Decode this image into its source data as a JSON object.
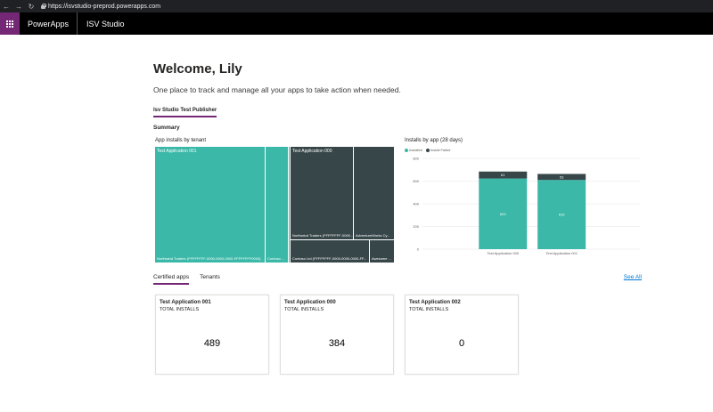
{
  "browser": {
    "back_icon": "←",
    "forward_icon": "→",
    "reload_icon": "↻",
    "url": "https://isvstudio-preprod.powerapps.com"
  },
  "header": {
    "app_name": "PowerApps",
    "studio_name": "ISV Studio",
    "brand_color": "#742774"
  },
  "page": {
    "welcome": "Welcome, Lily",
    "subtitle": "One place to track and manage all your apps to take action when needed.",
    "publisher_tab": "Isv Studio Test Publisher",
    "summary_label": "Summary"
  },
  "treemap": {
    "title": "App installs by tenant",
    "cells": [
      {
        "top_label": "Test Application 001",
        "bottom_label": "Northwind Traders (FFFFFFFF-0000-0000-0000-FFFFFFFF0003) ..."
      },
      {
        "top_label": "",
        "bottom_label": "Contoso ..."
      },
      {
        "top_label": "",
        "bottom_label": ""
      },
      {
        "top_label": "Test Application 000",
        "bottom_label": "Northwind Traders (FFFFFFFF-0000..."
      },
      {
        "top_label": "",
        "bottom_label": "AdventureWorks Cy..."
      },
      {
        "top_label": "",
        "bottom_label": "Contoso Ltd (FFFFFFFF-0000-0000-0000-FF..."
      },
      {
        "top_label": "",
        "bottom_label": "Awesome ..."
      }
    ]
  },
  "installs_chart": {
    "title": "Installs by app (28 days)",
    "legend": [
      {
        "name": "Installed",
        "color": "#3bb8a8"
      },
      {
        "name": "Install Failed",
        "color": "#374649"
      }
    ]
  },
  "chart_data": {
    "type": "bar",
    "stacked": true,
    "categories": [
      "Test Application 000",
      "Test Application 001"
    ],
    "series": [
      {
        "name": "Installed",
        "values": [
          623,
          610
        ],
        "color": "#3bb8a8"
      },
      {
        "name": "Install Failed",
        "values": [
          61,
          53
        ],
        "color": "#374649"
      }
    ],
    "ylim": [
      0,
      800
    ],
    "yticks": [
      0,
      200,
      400,
      600,
      800
    ],
    "grid": true,
    "legend_position": "top-left"
  },
  "tabs": {
    "certified": "Certified apps",
    "tenants": "Tenants",
    "see_all": "See All"
  },
  "cards": [
    {
      "title": "Test Application 001",
      "subtitle": "TOTAL INSTALLS",
      "value": "489"
    },
    {
      "title": "Test Application 000",
      "subtitle": "TOTAL INSTALLS",
      "value": "384"
    },
    {
      "title": "Test Application 002",
      "subtitle": "TOTAL INSTALLS",
      "value": "0"
    }
  ]
}
